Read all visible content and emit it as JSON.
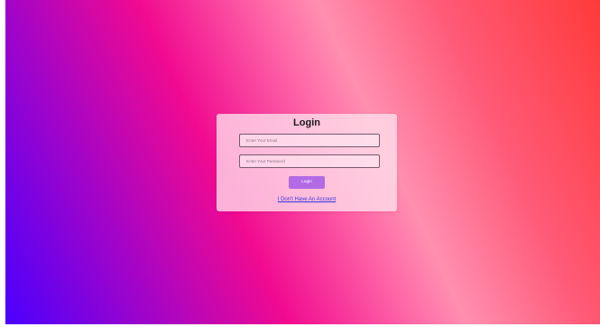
{
  "login_card": {
    "title": "Login",
    "email_placeholder": "Enter Your Email",
    "password_placeholder": "Enter Your Password",
    "login_button_label": "Login",
    "no_account_link": "I Don't Have An Account"
  },
  "colors": {
    "background_gradient": [
      "#4a00ff",
      "#f10a90",
      "#ff8fb0",
      "#ff3a3a"
    ],
    "button": "#b26ae5",
    "link": "#3a32e0"
  }
}
